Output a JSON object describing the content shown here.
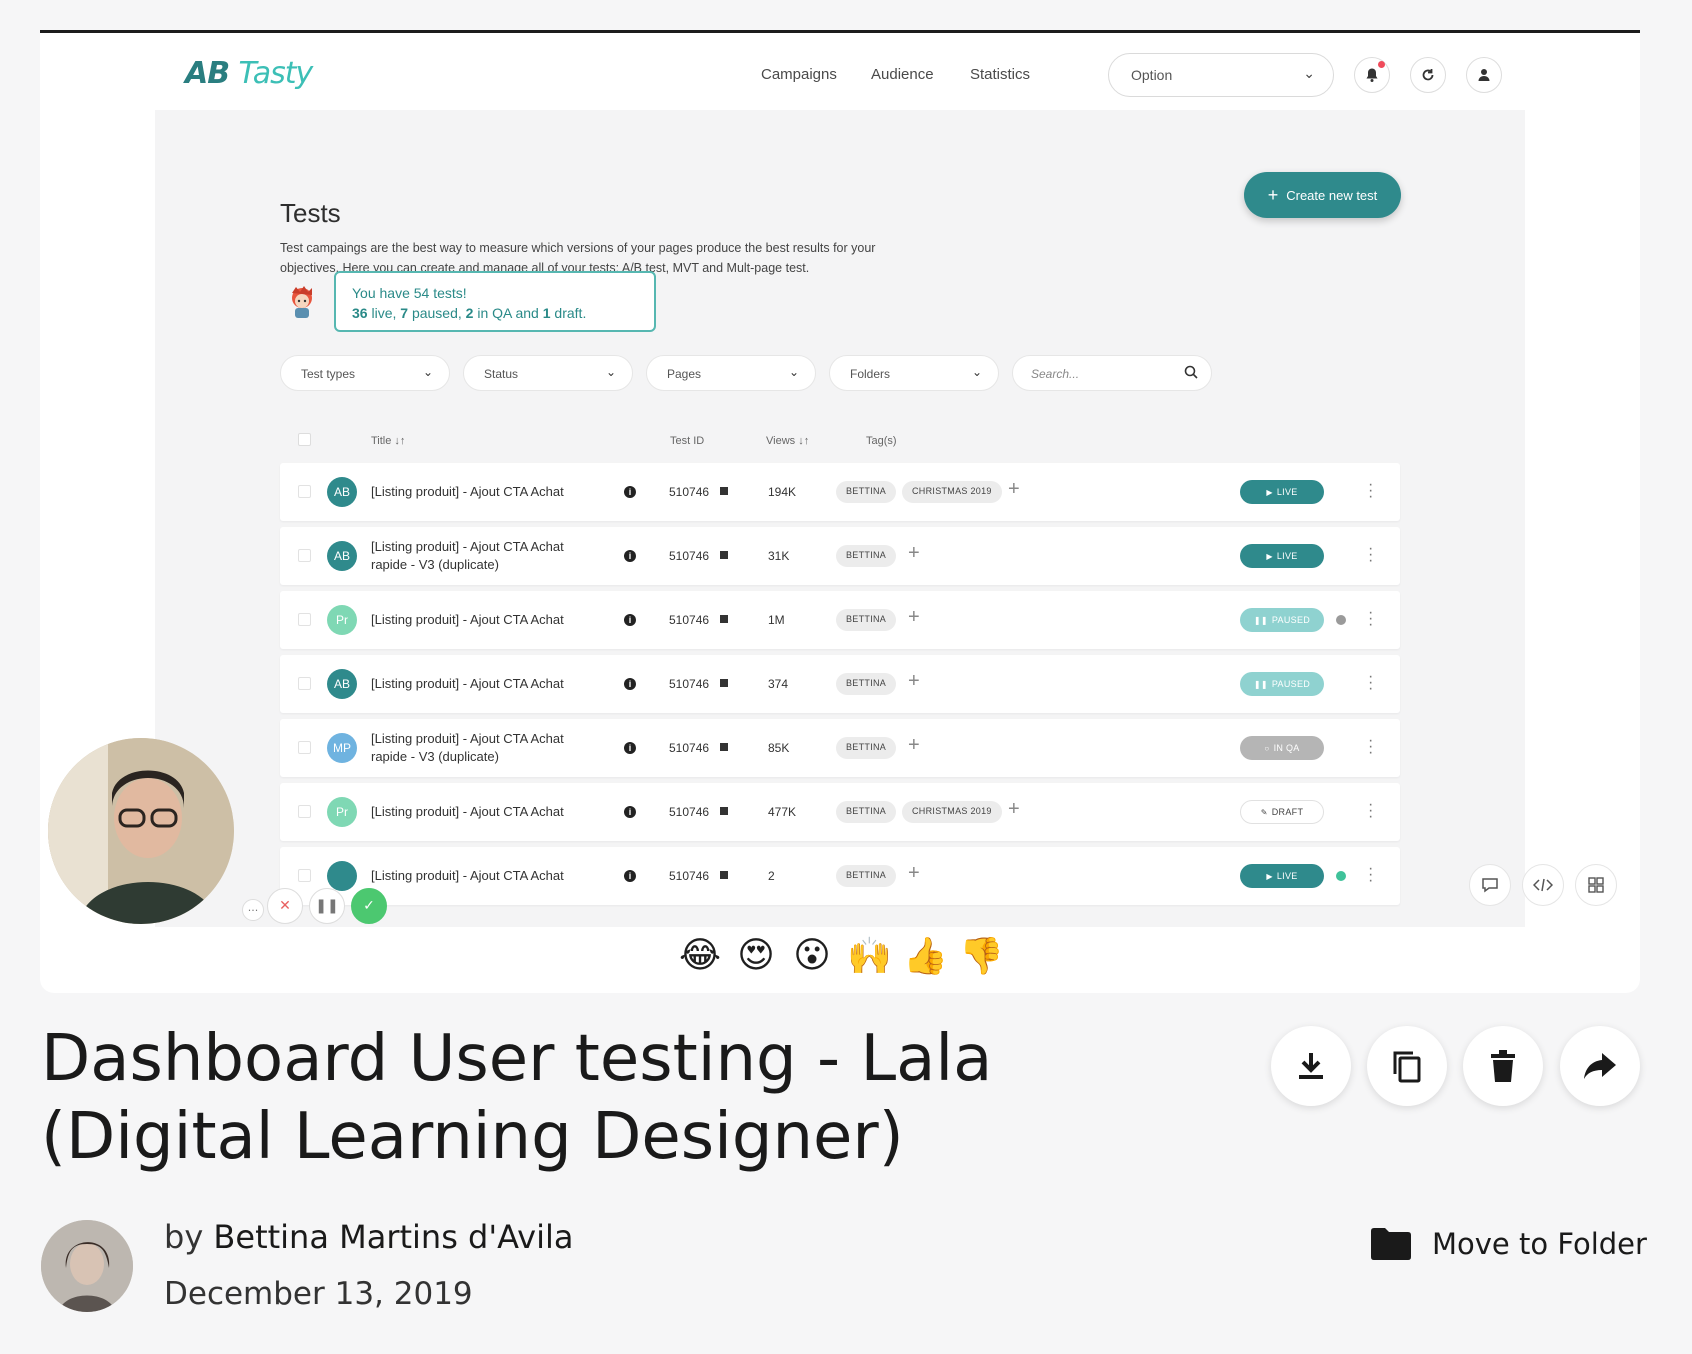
{
  "app": {
    "logo_ab": "AB",
    "logo_tasty": "Tasty",
    "nav": [
      "Campaigns",
      "Audience",
      "Statistics"
    ],
    "select_value": "Option"
  },
  "tests": {
    "title": "Tests",
    "description": "Test campaings are the best way to measure which versions of your pages produce the best results for your objectives. Here you can create and manage all of your tests: A/B test, MVT and Mult-page test.",
    "create_button": "Create new test",
    "bubble_line1": "You have 54 tests!",
    "bubble_live": "36",
    "bubble_live_label": " live, ",
    "bubble_paused": "7",
    "bubble_paused_label": " paused, ",
    "bubble_qa": "2",
    "bubble_qa_label": " in QA and ",
    "bubble_draft": "1",
    "bubble_draft_label": " draft.",
    "filters": [
      "Test types",
      "Status",
      "Pages",
      "Folders"
    ],
    "search_placeholder": "Search...",
    "columns": {
      "title": "Title",
      "test_id": "Test ID",
      "views": "Views",
      "tags": "Tag(s)"
    },
    "rows": [
      {
        "avatar": "AB",
        "avatar_color": "#2f8a8c",
        "title": "[Listing produit] - Ajout CTA Achat",
        "test_id": "510746",
        "views": "194K",
        "tags": [
          "BETTINA",
          "CHRISTMAS 2019"
        ],
        "status": "LIVE"
      },
      {
        "avatar": "AB",
        "avatar_color": "#2f8a8c",
        "title": "[Listing produit] - Ajout CTA Achat rapide - V3 (duplicate)",
        "test_id": "510746",
        "views": "31K",
        "tags": [
          "BETTINA"
        ],
        "status": "LIVE"
      },
      {
        "avatar": "Pr",
        "avatar_color": "#7fd8b4",
        "title": "[Listing produit] - Ajout CTA Achat",
        "test_id": "510746",
        "views": "1M",
        "tags": [
          "BETTINA"
        ],
        "status": "PAUSED"
      },
      {
        "avatar": "AB",
        "avatar_color": "#2f8a8c",
        "title": "[Listing produit] - Ajout CTA Achat",
        "test_id": "510746",
        "views": "374",
        "tags": [
          "BETTINA"
        ],
        "status": "PAUSED"
      },
      {
        "avatar": "MP",
        "avatar_color": "#6fb3e0",
        "title": "[Listing produit] - Ajout CTA Achat rapide - V3 (duplicate)",
        "test_id": "510746",
        "views": "85K",
        "tags": [
          "BETTINA"
        ],
        "status": "IN QA"
      },
      {
        "avatar": "Pr",
        "avatar_color": "#7fd8b4",
        "title": "[Listing produit] - Ajout CTA Achat",
        "test_id": "510746",
        "views": "477K",
        "tags": [
          "BETTINA",
          "CHRISTMAS 2019"
        ],
        "status": "DRAFT"
      },
      {
        "avatar": "",
        "avatar_color": "#2f8a8c",
        "title": "[Listing produit] - Ajout CTA Achat",
        "test_id": "510746",
        "views": "2",
        "tags": [
          "BETTINA"
        ],
        "status": "LIVE"
      }
    ]
  },
  "video": {
    "reactions": [
      "😂",
      "😍",
      "😮",
      "🙌",
      "👍",
      "👎"
    ]
  },
  "page": {
    "title": "Dashboard User testing - Lala (Digital Learning Designer)",
    "by_prefix": "by ",
    "author": "Bettina Martins d'Avila",
    "date": "December 13, 2019",
    "move_to_folder": "Move to Folder"
  }
}
